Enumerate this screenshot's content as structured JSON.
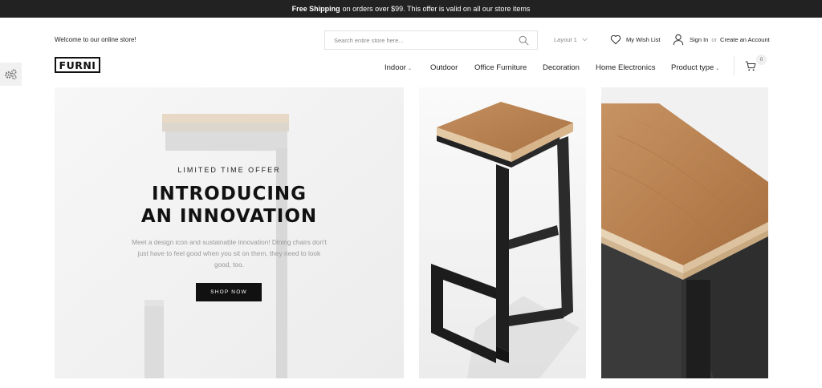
{
  "topbar": {
    "bold_text": "Free Shipping",
    "text": "on orders over $99. This offer is valid on all our store items"
  },
  "header": {
    "welcome": "Welcome to our online store!",
    "search_placeholder": "Search entire store here...",
    "layout_label": "Layout 1",
    "wishlist_label": "My Wish List",
    "sign_in": "Sign In",
    "or": "or",
    "create_account": "Create an Account"
  },
  "logo": "FURNI",
  "nav": {
    "items": [
      "Indoor",
      "Outdoor",
      "Office Furniture",
      "Decoration",
      "Home Electronics",
      "Product type"
    ]
  },
  "cart": {
    "count": "0"
  },
  "hero": {
    "offer": "LIMITED TIME OFFER",
    "headline_1": "INTRODUCING",
    "headline_2": "AN INNOVATION",
    "description": "Meet a design icon and sustainable innovation! Dining chairs don't just have to feel good when you sit on them, they need to look good, too.",
    "button": "SHOP NOW"
  },
  "icons": {
    "search": "search-icon",
    "heart": "heart-icon",
    "user": "user-icon",
    "cart": "cart-icon",
    "settings": "gears-icon"
  },
  "colors": {
    "topbar_bg": "#222222",
    "button_bg": "#111111",
    "wood": "#b9855a"
  }
}
